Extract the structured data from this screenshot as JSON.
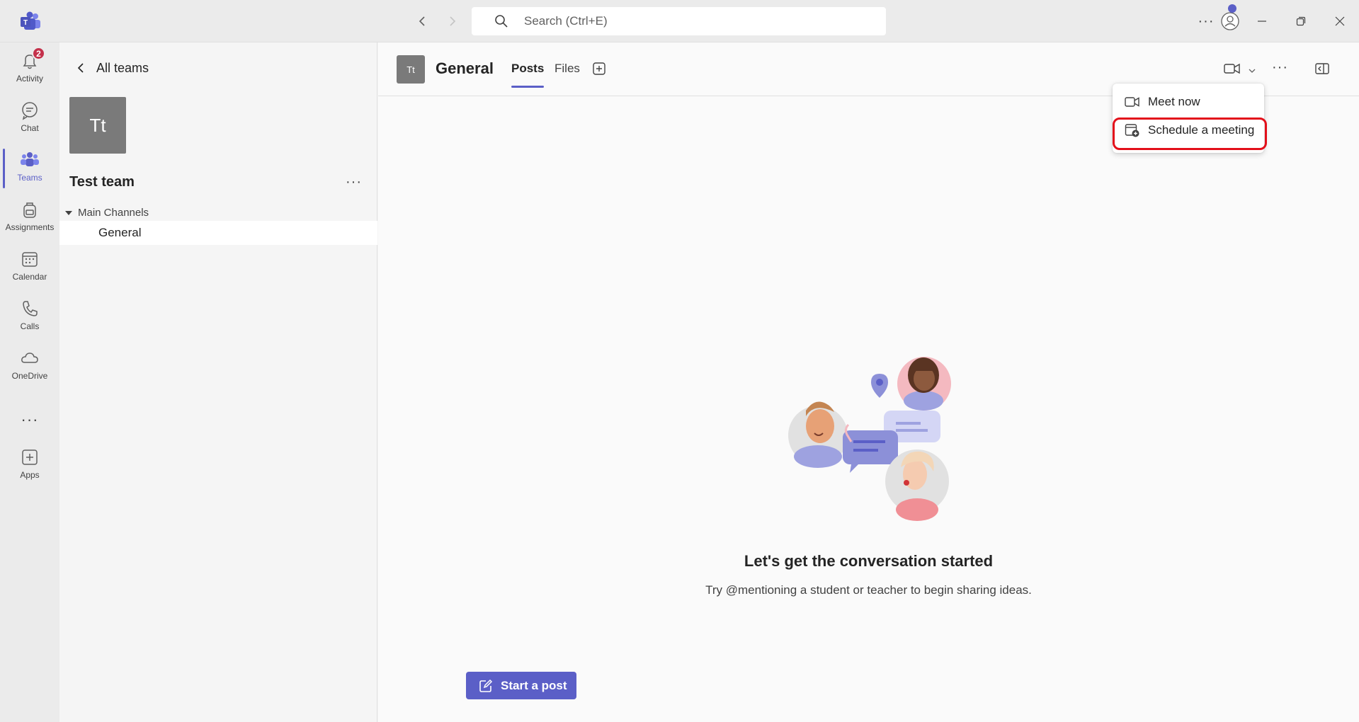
{
  "titlebar": {
    "search_placeholder": "Search (Ctrl+E)",
    "more_label": "···"
  },
  "rail": {
    "activity": {
      "label": "Activity",
      "badge": "2"
    },
    "chat": {
      "label": "Chat"
    },
    "teams": {
      "label": "Teams"
    },
    "assignments": {
      "label": "Assignments"
    },
    "calendar": {
      "label": "Calendar"
    },
    "calls": {
      "label": "Calls"
    },
    "onedrive": {
      "label": "OneDrive"
    },
    "more": {
      "label": "···"
    },
    "apps": {
      "label": "Apps"
    }
  },
  "leftpane": {
    "back_label": "All teams",
    "team_initials": "Tt",
    "team_name": "Test team",
    "more_label": "···",
    "section_label": "Main Channels",
    "channels": [
      {
        "name": "General"
      }
    ]
  },
  "channel": {
    "initials": "Tt",
    "title": "General",
    "tabs": [
      {
        "label": "Posts"
      },
      {
        "label": "Files"
      }
    ],
    "more_label": "···"
  },
  "dropdown": {
    "items": [
      {
        "label": "Meet now"
      },
      {
        "label": "Schedule a meeting"
      }
    ]
  },
  "empty_state": {
    "title": "Let's get the conversation started",
    "subtitle": "Try @mentioning a student or teacher to begin sharing ideas."
  },
  "compose": {
    "start_post_label": "Start a post"
  },
  "colors": {
    "accent": "#5b5fc7",
    "badge": "#c4314b",
    "highlight": "#e3101b"
  }
}
